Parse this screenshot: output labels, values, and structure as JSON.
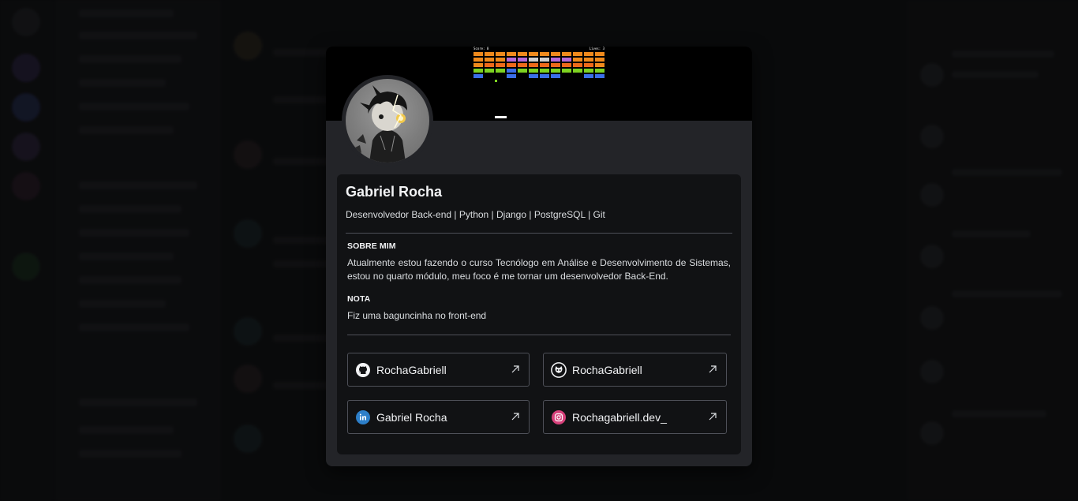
{
  "profile": {
    "name": "Gabriel Rocha",
    "tagline": "Desenvolvedor Back-end | Python | Django | PostgreSQL | Git",
    "about_title": "SOBRE MIM",
    "about_text": "Atualmente estou fazendo o curso Tecnólogo em Análise e Desenvolvimento de Sistemas, estou no quarto módulo, meu foco é me tornar um desenvolvedor Back-End.",
    "note_title": "NOTA",
    "note_text": "Fiz uma baguncinha no front-end"
  },
  "banner": {
    "score_label": "Score: 0",
    "lives_label": "Lives: 3"
  },
  "links": [
    {
      "label": "RochaGabriell",
      "icon": "github-icon"
    },
    {
      "label": "RochaGabriell",
      "icon": "gitlab-icon"
    },
    {
      "label": "Gabriel Rocha",
      "icon": "linkedin-icon"
    },
    {
      "label": "Rochagabriell.dev_",
      "icon": "instagram-icon"
    }
  ],
  "colors": {
    "modal_bg": "#232428",
    "card_bg": "#111214",
    "linkedin": "#0a66c2",
    "instagram": "#d6407a"
  }
}
